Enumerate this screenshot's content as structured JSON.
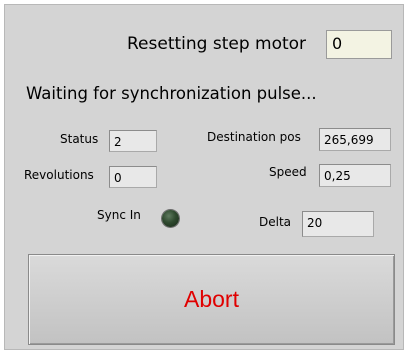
{
  "header": {
    "title_label": "Resetting step motor",
    "title_value": "0"
  },
  "status_message": "Waiting for synchronization pulse...",
  "fields": {
    "status": {
      "label": "Status",
      "value": "2"
    },
    "revolutions": {
      "label": "Revolutions",
      "value": "0"
    },
    "destination_pos": {
      "label": "Destination pos",
      "value": "265,699"
    },
    "speed": {
      "label": "Speed",
      "value": "0,25"
    },
    "delta": {
      "label": "Delta",
      "value": "20"
    }
  },
  "sync_in": {
    "label": "Sync In",
    "state": "off",
    "color": "#2f4a2f"
  },
  "abort_button": {
    "label": "Abort",
    "color": "#e00000"
  }
}
